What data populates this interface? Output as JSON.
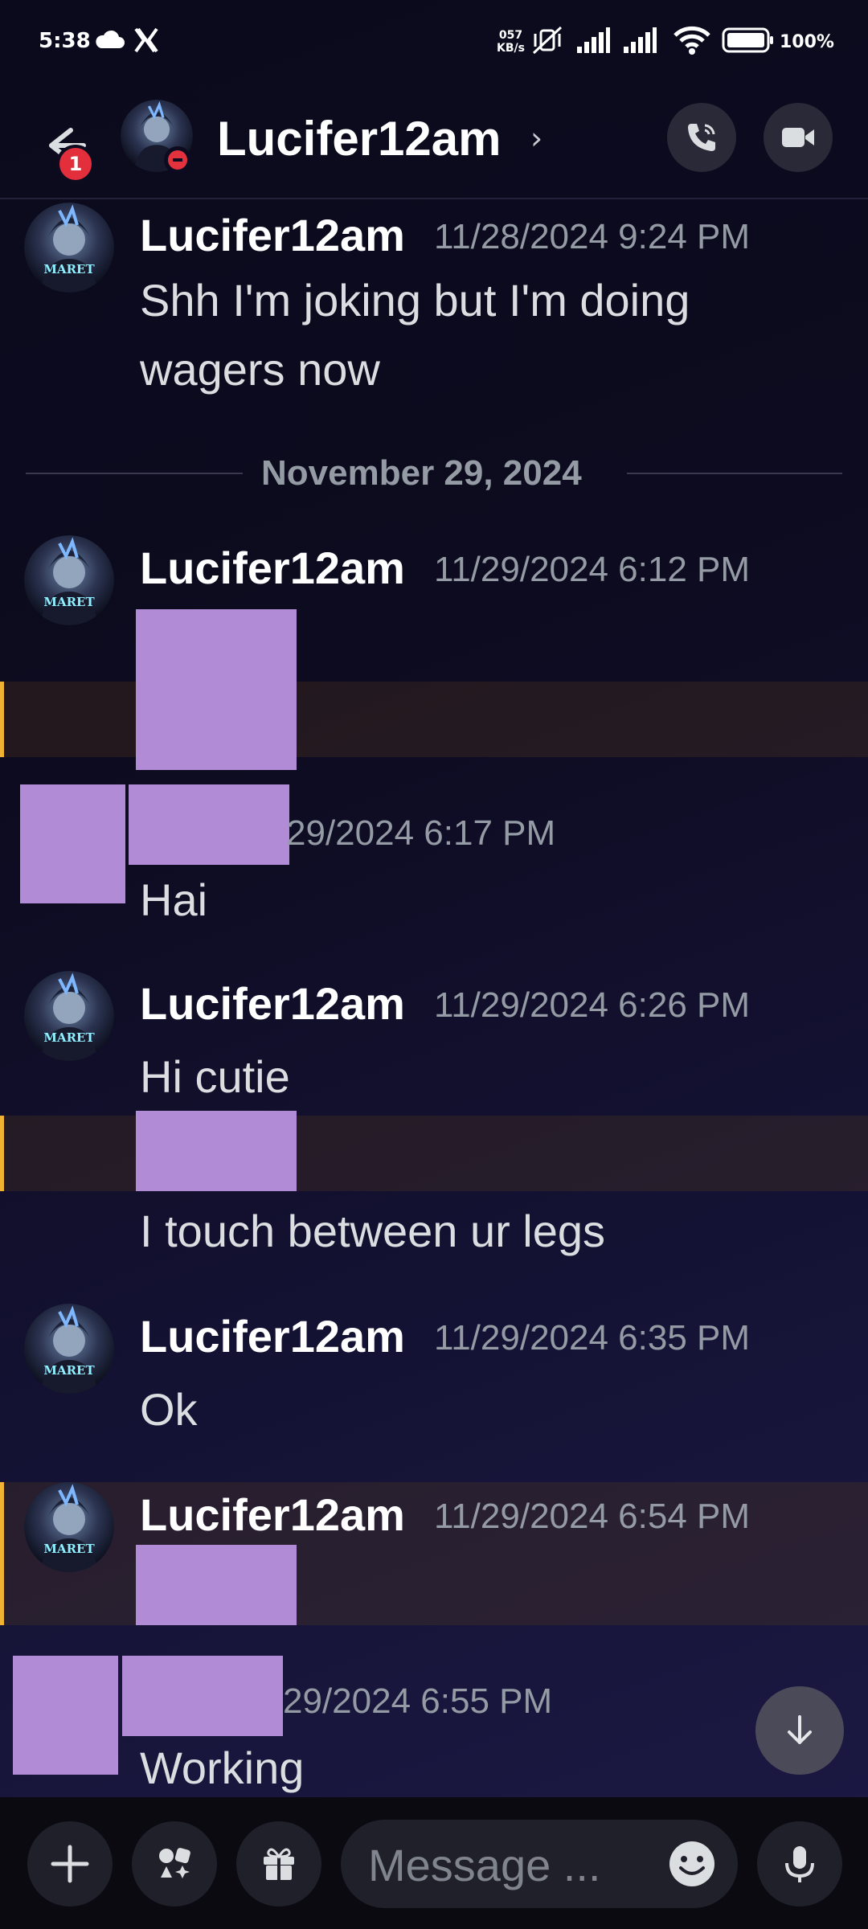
{
  "status_bar": {
    "time": "5:38",
    "net_speed_top": "057",
    "net_speed_unit": "KB/s",
    "battery": "100%"
  },
  "header": {
    "back_badge": "1",
    "channel_name": "Lucifer12am",
    "avatar_text": "Maret"
  },
  "messages": [
    {
      "username": "Lucifer12am",
      "timestamp": "11/28/2024 9:24 PM",
      "lines": [
        "Shh I'm joking but I'm doing",
        "wagers now"
      ]
    },
    {
      "divider": "November 29, 2024"
    },
    {
      "username": "Lucifer12am",
      "timestamp": "11/29/2024 6:12 PM"
    },
    {
      "timestamp_partial": "29/2024 6:17 PM",
      "lines": [
        "Hai"
      ]
    },
    {
      "username": "Lucifer12am",
      "timestamp": "11/29/2024 6:26 PM",
      "lines": [
        "Hi cutie"
      ]
    },
    {
      "lines": [
        "I touch between ur legs"
      ]
    },
    {
      "username": "Lucifer12am",
      "timestamp": "11/29/2024 6:35 PM",
      "lines": [
        "Ok"
      ]
    },
    {
      "username": "Lucifer12am",
      "timestamp": "11/29/2024 6:54 PM"
    },
    {
      "timestamp_partial": "29/2024 6:55 PM",
      "lines": [
        "Working"
      ]
    }
  ],
  "composer": {
    "placeholder": "Message ..."
  },
  "colors": {
    "highlight_bar": "#f0b232",
    "redaction": "#b18bd6",
    "dnd": "#e2323d"
  },
  "icons": [
    "wifi-icon",
    "signal-icon",
    "battery-icon",
    "back-arrow-icon",
    "phone-icon",
    "video-icon",
    "plus-icon",
    "apps-icon",
    "gift-icon",
    "emoji-icon",
    "mic-icon",
    "arrow-down-icon"
  ]
}
